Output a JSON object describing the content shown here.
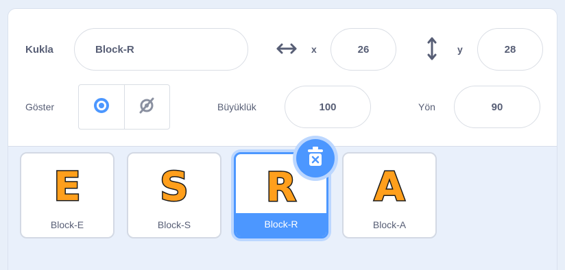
{
  "sprite": {
    "label": "Kukla",
    "name_value": "Block-R",
    "x_label": "x",
    "x_value": "26",
    "y_label": "y",
    "y_value": "28",
    "show_label": "Göster",
    "size_label": "Büyüklük",
    "size_value": "100",
    "direction_label": "Yön",
    "direction_value": "90"
  },
  "sprites": [
    {
      "letter": "E",
      "name": "Block-E",
      "selected": false
    },
    {
      "letter": "S",
      "name": "Block-S",
      "selected": false
    },
    {
      "letter": "R",
      "name": "Block-R",
      "selected": true
    },
    {
      "letter": "A",
      "name": "Block-A",
      "selected": false
    }
  ],
  "colors": {
    "accent": "#4c97ff",
    "letter_fill": "#ff9f1c",
    "text": "#575e75"
  }
}
